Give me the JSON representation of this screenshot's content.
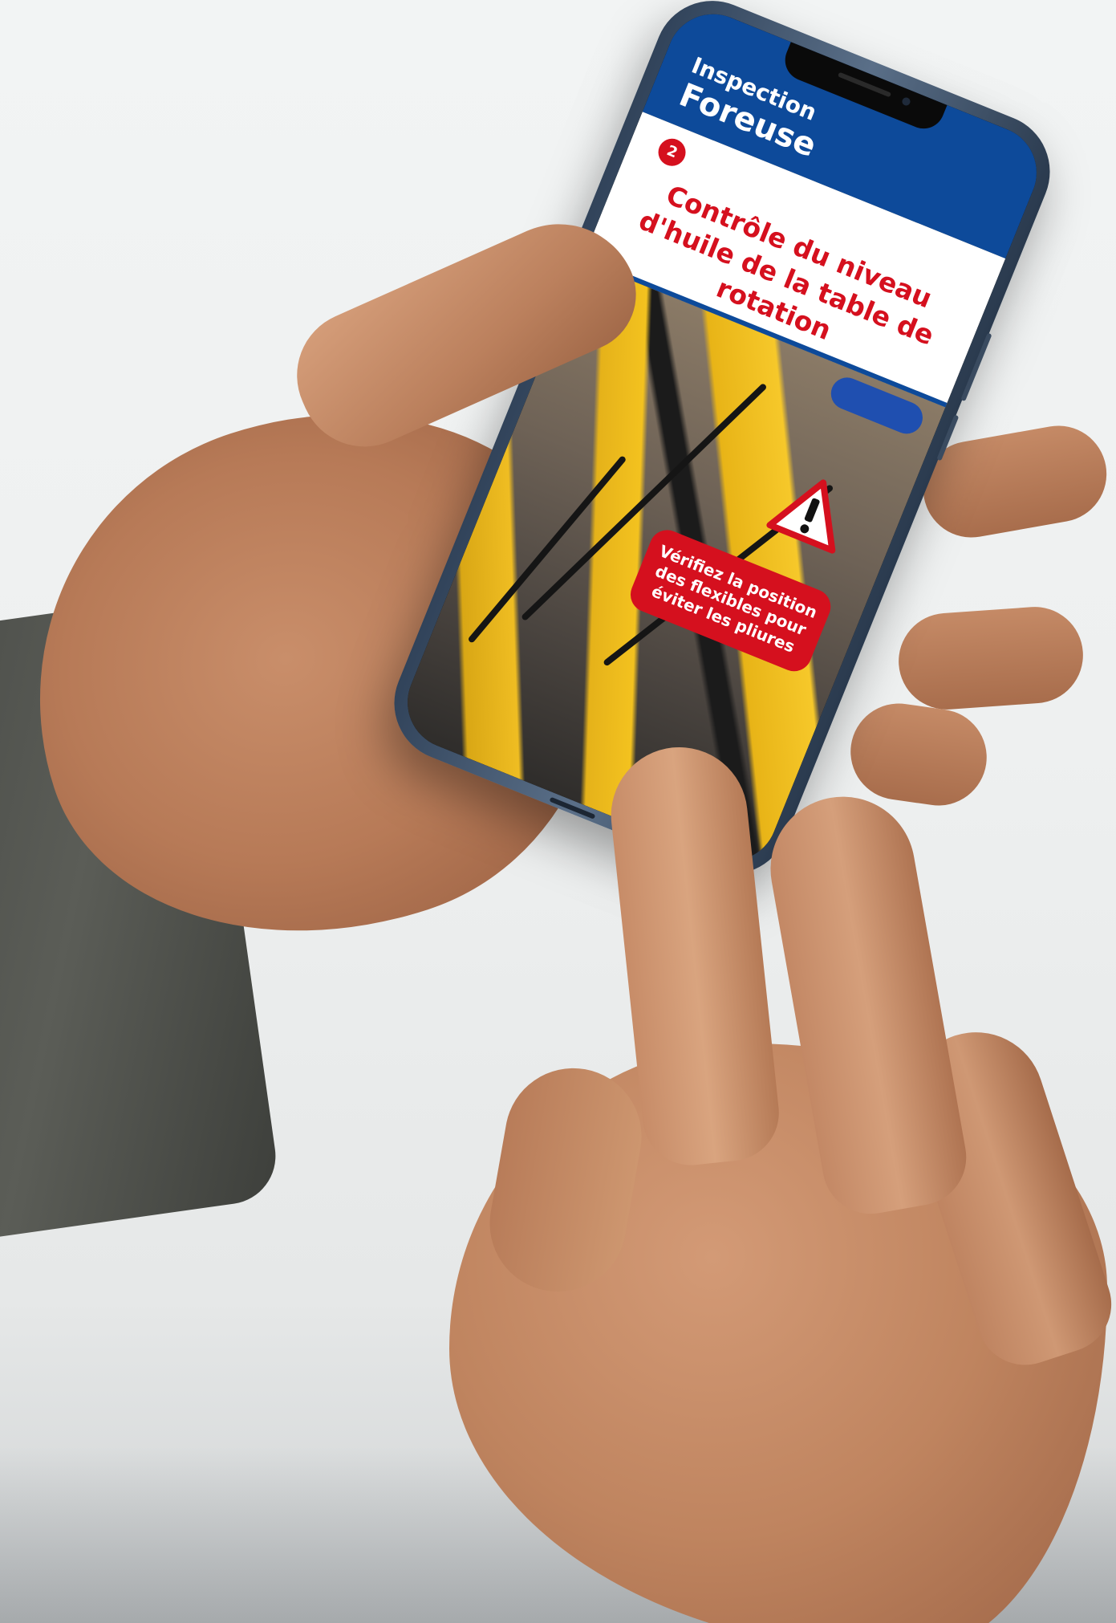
{
  "app": {
    "kicker": "Inspection",
    "title": "Foreuse"
  },
  "step": {
    "number": "2",
    "title": "Contrôle du niveau d'huile de la table de rotation"
  },
  "callout": {
    "text": "Vérifiez la position des flexibles pour éviter les pliures"
  },
  "icons": {
    "warning": "warning-triangle-icon"
  },
  "colors": {
    "brand_blue": "#0d4a9a",
    "alert_red": "#d5101e",
    "machine_yellow": "#f3c21f"
  }
}
